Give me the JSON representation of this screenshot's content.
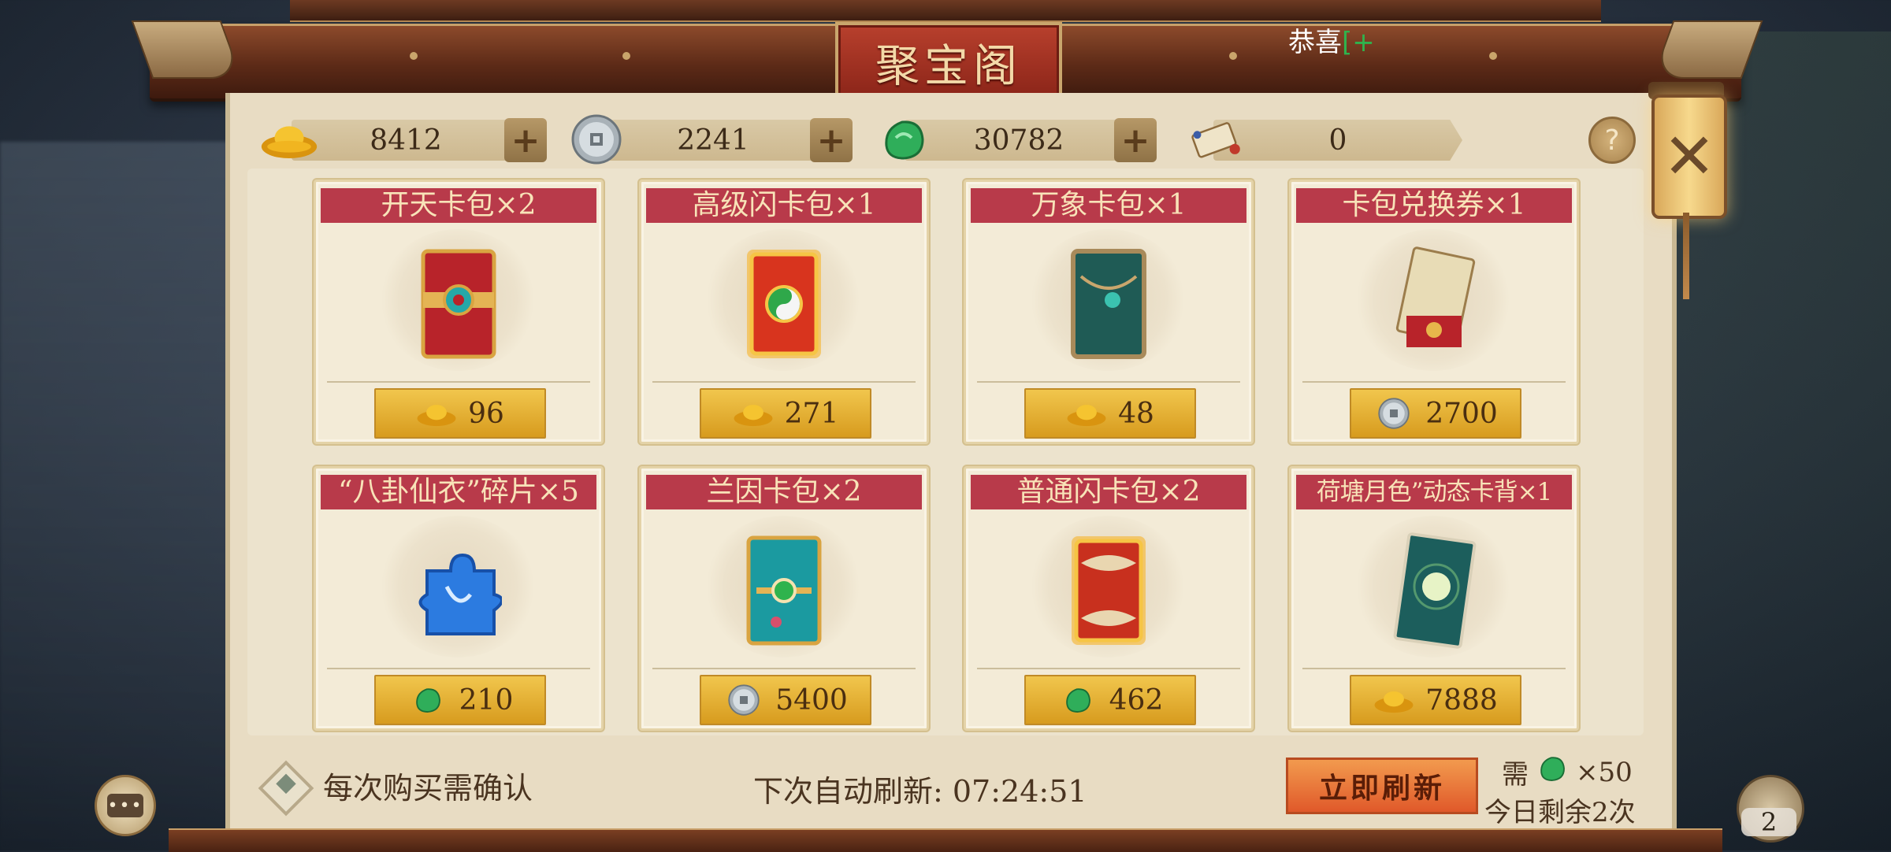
{
  "title": "聚宝阁",
  "broadcast": {
    "text": "恭喜",
    "tail": "[+"
  },
  "currencies": [
    {
      "name": "gold-ingot",
      "value": "8412"
    },
    {
      "name": "silver-coin",
      "value": "2241"
    },
    {
      "name": "jade",
      "value": "30782"
    },
    {
      "name": "scroll",
      "value": "0"
    }
  ],
  "items": [
    {
      "name": "开天卡包×2",
      "price": "96",
      "currency": "gold-ingot-icon"
    },
    {
      "name": "高级闪卡包×1",
      "price": "271",
      "currency": "gold-ingot-icon"
    },
    {
      "name": "万象卡包×1",
      "price": "48",
      "currency": "gold-ingot-icon"
    },
    {
      "name": "卡包兑换券×1",
      "price": "2700",
      "currency": "silver-coin-icon"
    },
    {
      "name": "“八卦仙衣”碎片×5",
      "price": "210",
      "currency": "jade-icon"
    },
    {
      "name": "兰因卡包×2",
      "price": "5400",
      "currency": "silver-coin-icon"
    },
    {
      "name": "普通闪卡包×2",
      "price": "462",
      "currency": "jade-icon"
    },
    {
      "name": "荷塘月色”动态卡背×1",
      "price": "7888",
      "currency": "gold-ingot-icon"
    }
  ],
  "bottom": {
    "confirm_label": "每次购买需确认",
    "refresh_label": "下次自动刷新: 07:24:51",
    "refresh_button": "立即刷新",
    "need_label": "需",
    "need_cost": "×50",
    "remaining": "今日剩余2次"
  },
  "chat_icon_text": "•••",
  "corner_count": "2",
  "colors": {
    "banner": "#b83a4a",
    "price_button": "#e8b23a",
    "panel": "#e8dcc3"
  }
}
